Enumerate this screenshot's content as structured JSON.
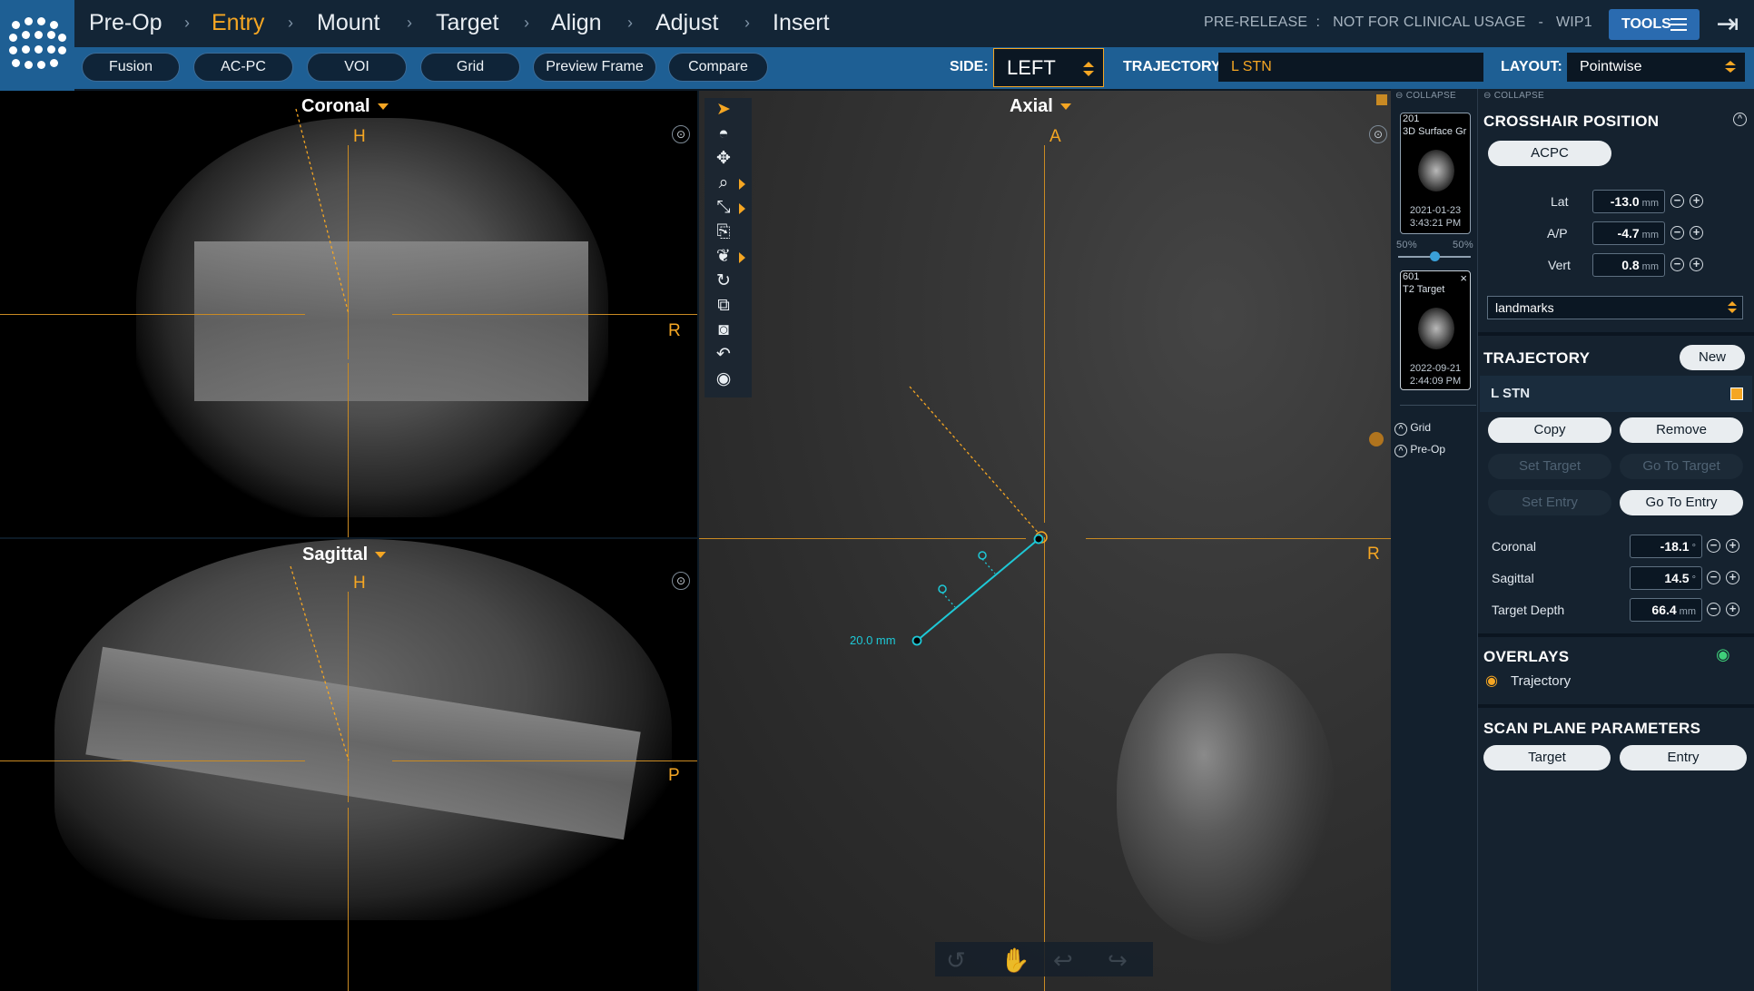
{
  "header": {
    "steps": [
      {
        "label": "Pre-Op",
        "active": false
      },
      {
        "label": "Entry",
        "active": true
      },
      {
        "label": "Mount",
        "active": false
      },
      {
        "label": "Target",
        "active": false
      },
      {
        "label": "Align",
        "active": false
      },
      {
        "label": "Adjust",
        "active": false
      },
      {
        "label": "Insert",
        "active": false
      }
    ],
    "chevron": "›",
    "notice": "PRE-RELEASE  :   NOT FOR CLINICAL USAGE   -   WIP1",
    "tools_label": "TOOLS",
    "accent": "#f5a623",
    "brand": "#1e5f94"
  },
  "toolbar": {
    "buttons": [
      "Fusion",
      "AC-PC",
      "VOI",
      "Grid",
      "Preview Frame",
      "Compare"
    ],
    "side_label": "SIDE:",
    "side_value": "LEFT",
    "trajectory_label": "TRAJECTORY:",
    "trajectory_value": "L STN",
    "layout_label": "LAYOUT:",
    "layout_value": "Pointwise"
  },
  "views": {
    "coronal": {
      "title": "Coronal",
      "top": "H",
      "right": "R"
    },
    "sagittal": {
      "title": "Sagittal",
      "top": "H",
      "right": "P"
    },
    "axial": {
      "title": "Axial",
      "top": "A",
      "right": "R",
      "measurement": "20.0 mm"
    }
  },
  "series": {
    "collapse_label": "COLLAPSE",
    "items": [
      {
        "number": "201",
        "name": "3D Surface Gr",
        "date": "2021-01-23",
        "time": "3:43:21 PM"
      },
      {
        "number": "601",
        "name": "T2 Target",
        "date": "2022-09-21",
        "time": "2:44:09 PM"
      }
    ],
    "blend_left": "50%",
    "blend_right": "50%",
    "blend_value": 0.5,
    "toggles": [
      "Grid",
      "Pre-Op"
    ]
  },
  "panel": {
    "collapse_label": "COLLAPSE",
    "crosshair": {
      "title": "CROSSHAIR POSITION",
      "acpc_button": "ACPC",
      "fields": [
        {
          "label": "Lat",
          "value": "-13.0",
          "unit": "mm"
        },
        {
          "label": "A/P",
          "value": "-4.7",
          "unit": "mm"
        },
        {
          "label": "Vert",
          "value": "0.8",
          "unit": "mm"
        }
      ],
      "landmarks": "landmarks"
    },
    "trajectory": {
      "title": "TRAJECTORY",
      "new_button": "New",
      "name": "L STN",
      "copy": "Copy",
      "remove": "Remove",
      "set_target": "Set Target",
      "go_to_target": "Go To Target",
      "set_entry": "Set Entry",
      "go_to_entry": "Go To Entry",
      "fields": [
        {
          "label": "Coronal",
          "value": "-18.1",
          "unit": "°"
        },
        {
          "label": "Sagittal",
          "value": "14.5",
          "unit": "°"
        },
        {
          "label": "Target Depth",
          "value": "66.4",
          "unit": "mm"
        }
      ]
    },
    "overlays": {
      "title": "OVERLAYS",
      "item": "Trajectory"
    },
    "scan_plane": {
      "title": "SCAN PLANE PARAMETERS",
      "target": "Target",
      "entry": "Entry"
    }
  }
}
